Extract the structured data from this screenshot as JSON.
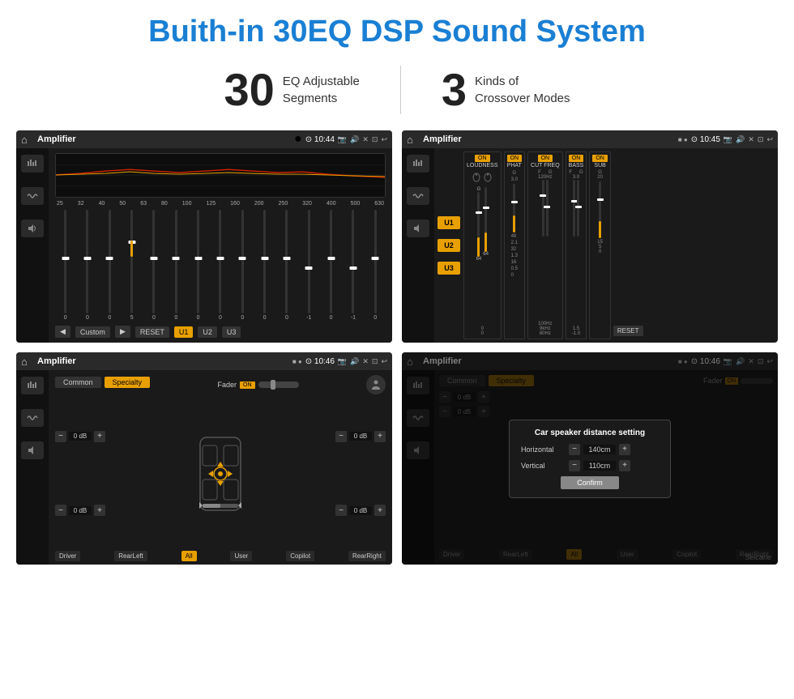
{
  "page": {
    "title": "Buith-in 30EQ DSP Sound System",
    "stats": [
      {
        "number": "30",
        "label": "EQ Adjustable\nSegments"
      },
      {
        "number": "3",
        "label": "Kinds of\nCrossover Modes"
      }
    ]
  },
  "screen1": {
    "title": "Amplifier",
    "time": "10:44",
    "frequencies": [
      "25",
      "32",
      "40",
      "50",
      "63",
      "80",
      "100",
      "125",
      "160",
      "200",
      "250",
      "320",
      "400",
      "500",
      "630"
    ],
    "sliders": [
      "0",
      "0",
      "0",
      "5",
      "0",
      "0",
      "0",
      "0",
      "0",
      "0",
      "0",
      "-1",
      "0",
      "-1"
    ],
    "buttons": {
      "prev": "◀",
      "preset": "Custom",
      "next": "▶",
      "reset": "RESET",
      "u1": "U1",
      "u2": "U2",
      "u3": "U3"
    }
  },
  "screen2": {
    "title": "Amplifier",
    "time": "10:45",
    "channels": [
      "LOUDNESS",
      "PHAT",
      "CUT FREQ",
      "BASS",
      "SUB"
    ],
    "on_labels": [
      "ON",
      "ON",
      "ON",
      "ON",
      "ON"
    ],
    "u_buttons": [
      "U1",
      "U2",
      "U3"
    ],
    "reset": "RESET"
  },
  "screen3": {
    "title": "Amplifier",
    "time": "10:46",
    "tabs": [
      "Common",
      "Specialty"
    ],
    "active_tab": "Specialty",
    "fader": "Fader",
    "fader_on": "ON",
    "db_values": [
      "0 dB",
      "0 dB",
      "0 dB",
      "0 dB"
    ],
    "nav_labels": [
      "Driver",
      "RearLeft",
      "All",
      "User",
      "Copilot",
      "RearRight"
    ],
    "all_label": "All"
  },
  "screen4": {
    "title": "Amplifier",
    "time": "10:46",
    "tabs": [
      "Common",
      "Specialty"
    ],
    "dialog": {
      "title": "Car speaker distance setting",
      "horizontal_label": "Horizontal",
      "horizontal_value": "140cm",
      "vertical_label": "Vertical",
      "vertical_value": "110cm",
      "confirm": "Confirm"
    },
    "db_values": [
      "0 dB",
      "0 dB"
    ],
    "nav_labels": [
      "Driver",
      "RearLeft",
      "User",
      "Copilot",
      "RearRight"
    ]
  },
  "watermark": "Seicane"
}
